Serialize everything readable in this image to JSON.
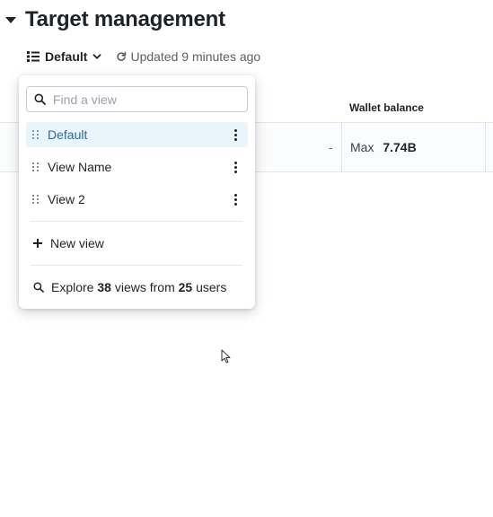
{
  "section": {
    "title": "Target management",
    "icon": "caret-down"
  },
  "toolbar": {
    "view_label": "Default",
    "updated_text": "Updated 9 minutes ago"
  },
  "table": {
    "column_wallet": "Wallet balance",
    "row": {
      "dash": "-",
      "max_label": "Max",
      "max_value": "7.74B"
    }
  },
  "dropdown": {
    "search_placeholder": "Find a view",
    "views": [
      {
        "label": "Default",
        "selected": true
      },
      {
        "label": "View Name",
        "selected": false
      },
      {
        "label": "View 2",
        "selected": false
      }
    ],
    "new_view_label": "New view",
    "explore": {
      "prefix": "Explore",
      "views_count": "38",
      "middle": "views from",
      "users_count": "25",
      "suffix": "users"
    }
  },
  "colors": {
    "selected_bg": "#eaf4fb",
    "selected_text": "#2d6aa0",
    "text": "#1f2328",
    "muted": "#5a6069"
  }
}
